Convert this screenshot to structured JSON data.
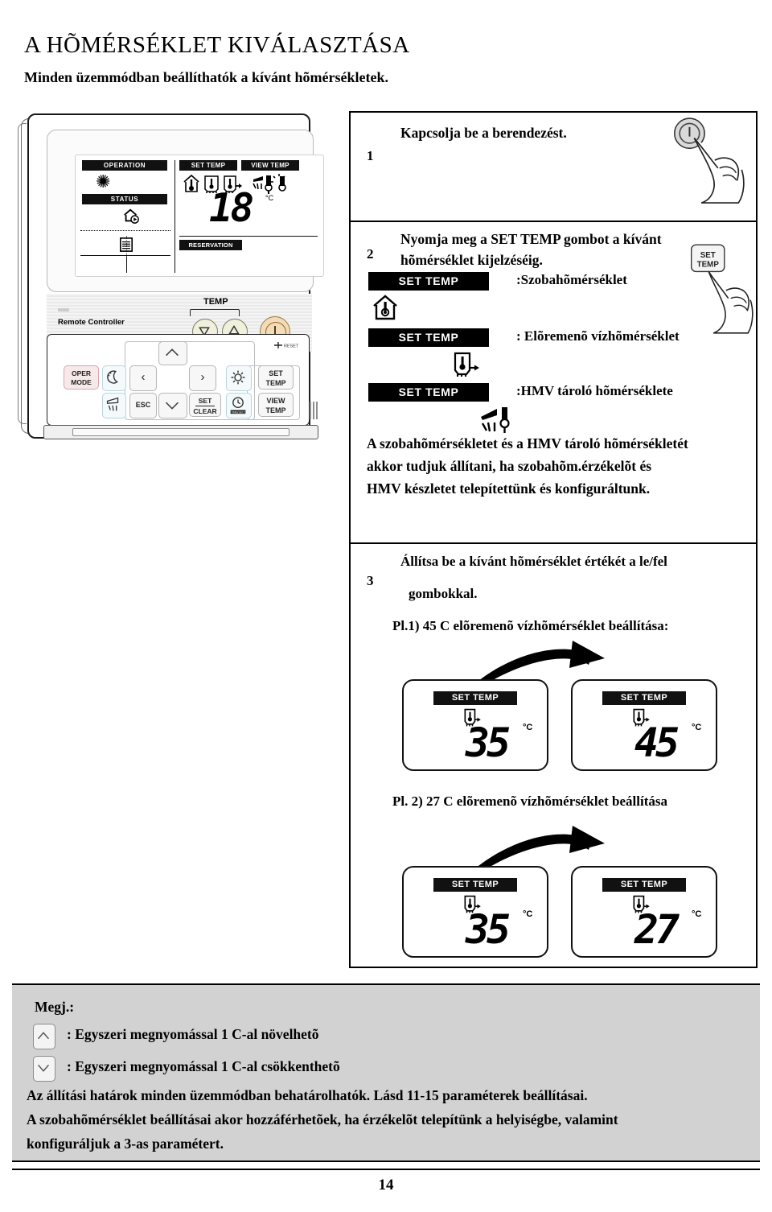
{
  "heading": {
    "title": "A HÕMÉRSÉKLET KIVÁLASZTÁSA",
    "subtitle": "Minden üzemmódban beállíthatók a kívánt hõmérsékletek."
  },
  "remote": {
    "lcd": {
      "operation_label": "OPERATION",
      "status_label": "STATUS",
      "set_temp_label": "SET TEMP",
      "view_temp_label": "VIEW TEMP",
      "reservation_label": "RESERVATION",
      "value": "18",
      "unit": "°C",
      "operation_icon": "snowflake-icon",
      "status_icon": "house-run-icon",
      "calendar_icon": "calendar-icon",
      "temp_icons": [
        "room-temp-icon",
        "water-temp-icon",
        "outgoing-water-temp-icon",
        "dhw-tank-temp-icon",
        "outdoor-temp-icon"
      ]
    },
    "temp_group_label": "TEMP",
    "device_label": "Remote Controller",
    "reset_label": "RESET",
    "keys": [
      {
        "name": "oper-mode",
        "line1": "OPER",
        "line2": "MODE"
      },
      {
        "name": "night-mode",
        "line1": "moon-icon",
        "line2": ""
      },
      {
        "name": "hot-water",
        "line1": "shower-icon",
        "line2": ""
      },
      {
        "name": "left",
        "line1": "‹",
        "line2": ""
      },
      {
        "name": "esc",
        "line1": "ESC",
        "line2": ""
      },
      {
        "name": "up",
        "line1": "∧",
        "line2": ""
      },
      {
        "name": "down",
        "line1": "∨",
        "line2": ""
      },
      {
        "name": "right",
        "line1": "›",
        "line2": ""
      },
      {
        "name": "set-clear",
        "line1": "SET",
        "line2": "CLEAR"
      },
      {
        "name": "settings",
        "line1": "gear-icon",
        "line2": ""
      },
      {
        "name": "timer",
        "line1": "clock-icon",
        "line2": "TIME(SEC)"
      },
      {
        "name": "set-temp",
        "line1": "SET",
        "line2": "TEMP"
      },
      {
        "name": "view-temp",
        "line1": "VIEW",
        "line2": "TEMP"
      }
    ]
  },
  "steps": [
    {
      "number": "1",
      "text": "Kapcsolja be a berendezést.",
      "illustration": "power-button-press-icon"
    },
    {
      "number": "2",
      "text_line1": "Nyomja meg a SET TEMP gombot a kívánt",
      "text_line2": "hõmérséklet kijelzéséig.",
      "button_label_line1": "SET",
      "button_label_line2": "TEMP",
      "illustration": "set-temp-button-press-icon",
      "options": [
        {
          "badge": "SET TEMP",
          "desc": ":Szobahõmérséklet",
          "icon": "house-thermometer-icon"
        },
        {
          "badge": "SET TEMP",
          "desc": ": Elõremenõ vízhõmérséklet",
          "icon": "outgoing-water-thermometer-icon"
        },
        {
          "badge": "SET TEMP",
          "desc": ":HMV tároló hõmérséklete",
          "icon": "shower-thermometer-icon"
        }
      ],
      "footnote_line1": "A szobahõmérsékletet és a HMV tároló hõmérsékletét",
      "footnote_line2": "akkor tudjuk állítani, ha szobahõm.érzékelõt és",
      "footnote_line3": "HMV készletet telepítettünk és konfiguráltunk."
    },
    {
      "number": "3",
      "text_line1": "Állítsa be a kívánt hõmérséklet értékét a le/fel",
      "text_line2": "gombokkal.",
      "example1_caption": "Pl.1) 45 C elõremenõ vízhõmérséklet beállítása:",
      "example2_caption": "Pl. 2) 27 C elõremenõ vízhõmérséklet beállítása",
      "example1": {
        "from": {
          "bar": "SET TEMP",
          "value": "35",
          "unit": "°C",
          "icon": "outgoing-water-thermometer-icon"
        },
        "to": {
          "bar": "SET TEMP",
          "value": "45",
          "unit": "°C",
          "icon": "outgoing-water-thermometer-icon"
        }
      },
      "example2": {
        "from": {
          "bar": "SET TEMP",
          "value": "35",
          "unit": "°C",
          "icon": "outgoing-water-thermometer-icon"
        },
        "to": {
          "bar": "SET TEMP",
          "value": "27",
          "unit": "°C",
          "icon": "outgoing-water-thermometer-icon"
        }
      }
    }
  ],
  "notes": {
    "title": "Megj.:",
    "up_key_icon": "chevron-up-icon",
    "down_key_icon": "chevron-down-icon",
    "up_text": ": Egyszeri megnyomással 1 C-al növelhetõ",
    "down_text": ": Egyszeri megnyomással 1 C-al csökkenthetõ",
    "line1": "Az állítási határok minden üzemmódban behatárolhatók. Lásd 11-15 paraméterek beállításai.",
    "line2": "A szobahõmérséklet beállításai akor hozzáférhetõek, ha érzékelõt telepítünk a helyiségbe, valamint",
    "line3": "konfiguráljuk a 3-as paramétert."
  },
  "page_number": "14",
  "colors": {
    "note_bg": "#d2d2d2",
    "badge_bg": "#000000",
    "oper_key": "#f7e9ea",
    "power_key": "#f3dcb5"
  }
}
